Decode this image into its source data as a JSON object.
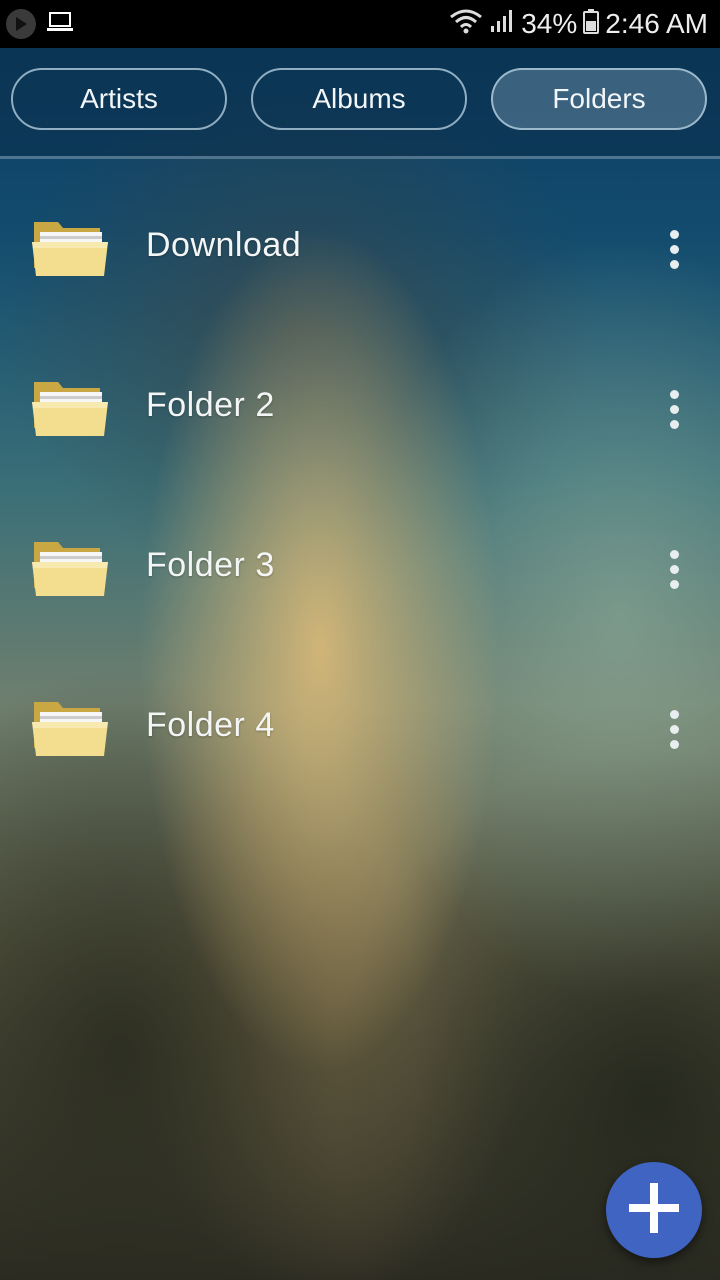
{
  "status_bar": {
    "battery": "34%",
    "time": "2:46 AM",
    "left_icons": [
      "play-circle-icon",
      "laptop-icon"
    ],
    "right_icons": [
      "wifi-icon",
      "signal-icon",
      "battery-icon"
    ]
  },
  "tabs": [
    {
      "label": "Artists",
      "active": false
    },
    {
      "label": "Albums",
      "active": false
    },
    {
      "label": "Folders",
      "active": true
    }
  ],
  "folders": [
    {
      "name": "Download",
      "icon": "folder-icon",
      "menu_icon": "more-vert-icon"
    },
    {
      "name": "Folder 2",
      "icon": "folder-icon",
      "menu_icon": "more-vert-icon"
    },
    {
      "name": "Folder 3",
      "icon": "folder-icon",
      "menu_icon": "more-vert-icon"
    },
    {
      "name": "Folder 4",
      "icon": "folder-icon",
      "menu_icon": "more-vert-icon"
    }
  ],
  "fab": {
    "icon": "plus-icon",
    "color": "#3f64c2"
  },
  "colors": {
    "status_bar_bg": "#000000",
    "tab_border": "#bed7e6",
    "folder_yellow": "#f0d98a"
  }
}
